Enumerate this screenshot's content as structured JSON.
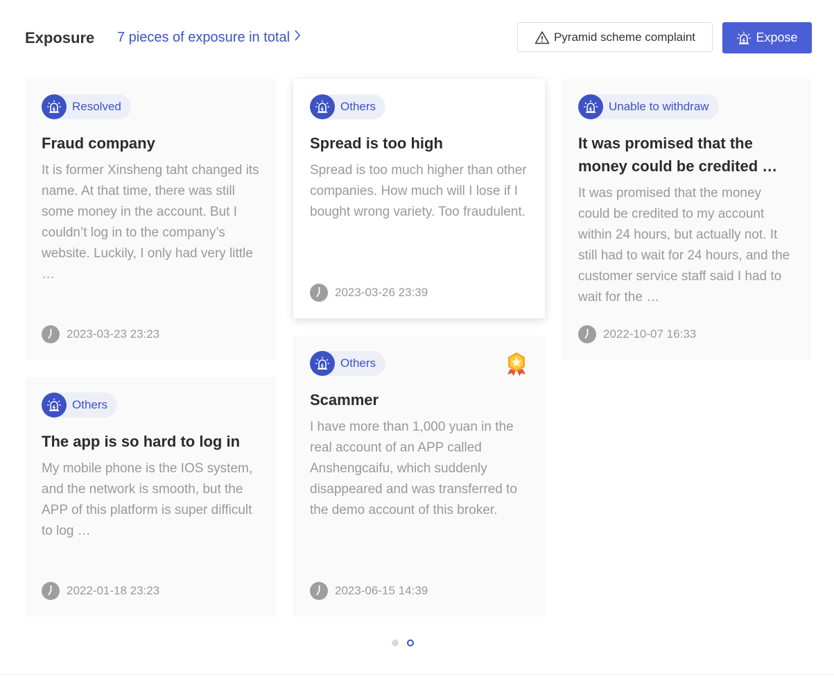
{
  "header": {
    "title": "Exposure",
    "total_link": "7 pieces of exposure in total",
    "complaint_button": "Pyramid scheme complaint",
    "expose_button": "Expose"
  },
  "cards": [
    {
      "tag": "Resolved",
      "title": "Fraud company",
      "text": "It is former Xinsheng taht changed its name. At that time, there was still some money in the account. But I couldn’t log in to the company’s website. Luckily, I only had very little …",
      "date": "2023-03-23 23:23"
    },
    {
      "tag": "Others",
      "title": "Spread is too high",
      "text": "Spread is too much higher than other companies. How much will I lose if I bought wrong variety. Too fraudulent.",
      "date": "2023-03-26 23:39"
    },
    {
      "tag": "Unable to withdraw",
      "title": "It was promised that the money could be credited …",
      "text": "It was promised that the money could be credited to my account within 24 hours, but actually not. It still had to wait for 24 hours, and the customer service staff said I had to wait for the …",
      "date": "2022-10-07 16:33"
    },
    {
      "tag": "Others",
      "title": "The app is so hard to log in",
      "text": "My mobile phone is the IOS system, and the network is smooth, but the APP of this platform is super difficult to log …",
      "date": "2022-01-18 23:23"
    },
    {
      "tag": "Others",
      "title": "Scammer",
      "text": "I have more than 1,000 yuan in the real account of an APP called Anshengcaifu, which suddenly disappeared and was transferred to the demo account of this broker.",
      "date": "2023-06-15 14:39"
    }
  ],
  "pagination": {
    "active_page": 2,
    "pages": 2
  },
  "colors": {
    "accent": "#3d52c4",
    "button_primary": "#4a5ed6",
    "tag_bg": "#eceff8",
    "text_muted": "#999999"
  },
  "icons": [
    "warning-icon",
    "alarm-icon",
    "clock-icon",
    "medal-icon",
    "chevron-right-icon"
  ]
}
